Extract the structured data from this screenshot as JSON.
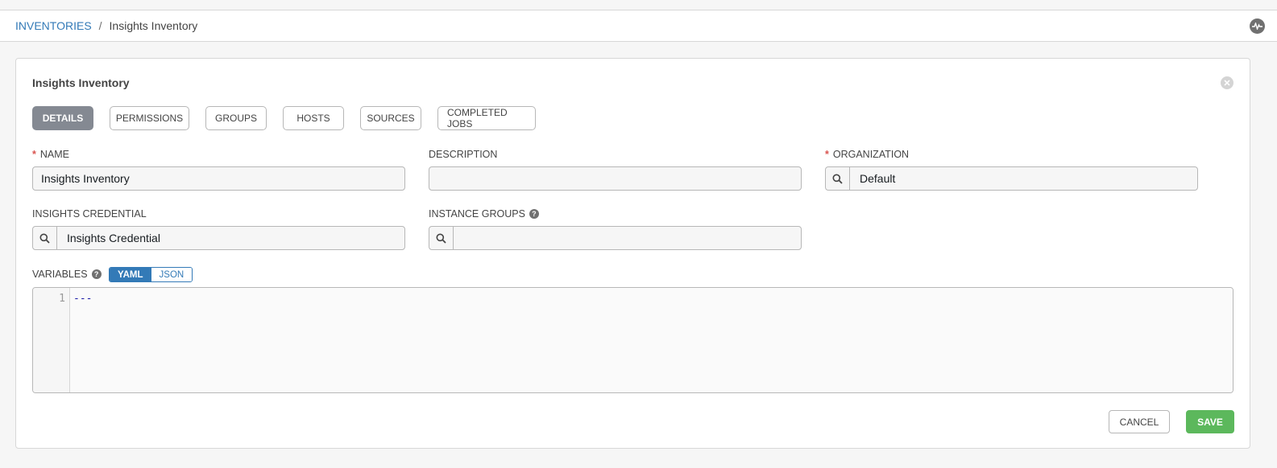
{
  "breadcrumb": {
    "root": "INVENTORIES",
    "separator": "/",
    "current": "Insights Inventory"
  },
  "panel": {
    "title": "Insights Inventory",
    "tabs": [
      {
        "label": "DETAILS",
        "active": true
      },
      {
        "label": "PERMISSIONS",
        "active": false
      },
      {
        "label": "GROUPS",
        "active": false
      },
      {
        "label": "HOSTS",
        "active": false
      },
      {
        "label": "SOURCES",
        "active": false
      },
      {
        "label": "COMPLETED JOBS",
        "active": false
      }
    ]
  },
  "form": {
    "name": {
      "label": "NAME",
      "required_mark": "*",
      "value": "Insights Inventory"
    },
    "description": {
      "label": "DESCRIPTION",
      "value": ""
    },
    "organization": {
      "label": "ORGANIZATION",
      "required_mark": "*",
      "value": "Default"
    },
    "insights_credential": {
      "label": "INSIGHTS CREDENTIAL",
      "value": "Insights Credential"
    },
    "instance_groups": {
      "label": "INSTANCE GROUPS",
      "value": ""
    },
    "variables": {
      "label": "VARIABLES",
      "modes": [
        "YAML",
        "JSON"
      ],
      "active_mode": "YAML",
      "line_numbers": [
        "1"
      ],
      "content": "---"
    }
  },
  "actions": {
    "cancel": "CANCEL",
    "save": "SAVE"
  },
  "colors": {
    "link": "#337ab7",
    "active_tab": "#848992",
    "save": "#5cb85c",
    "required": "#d9534f"
  }
}
